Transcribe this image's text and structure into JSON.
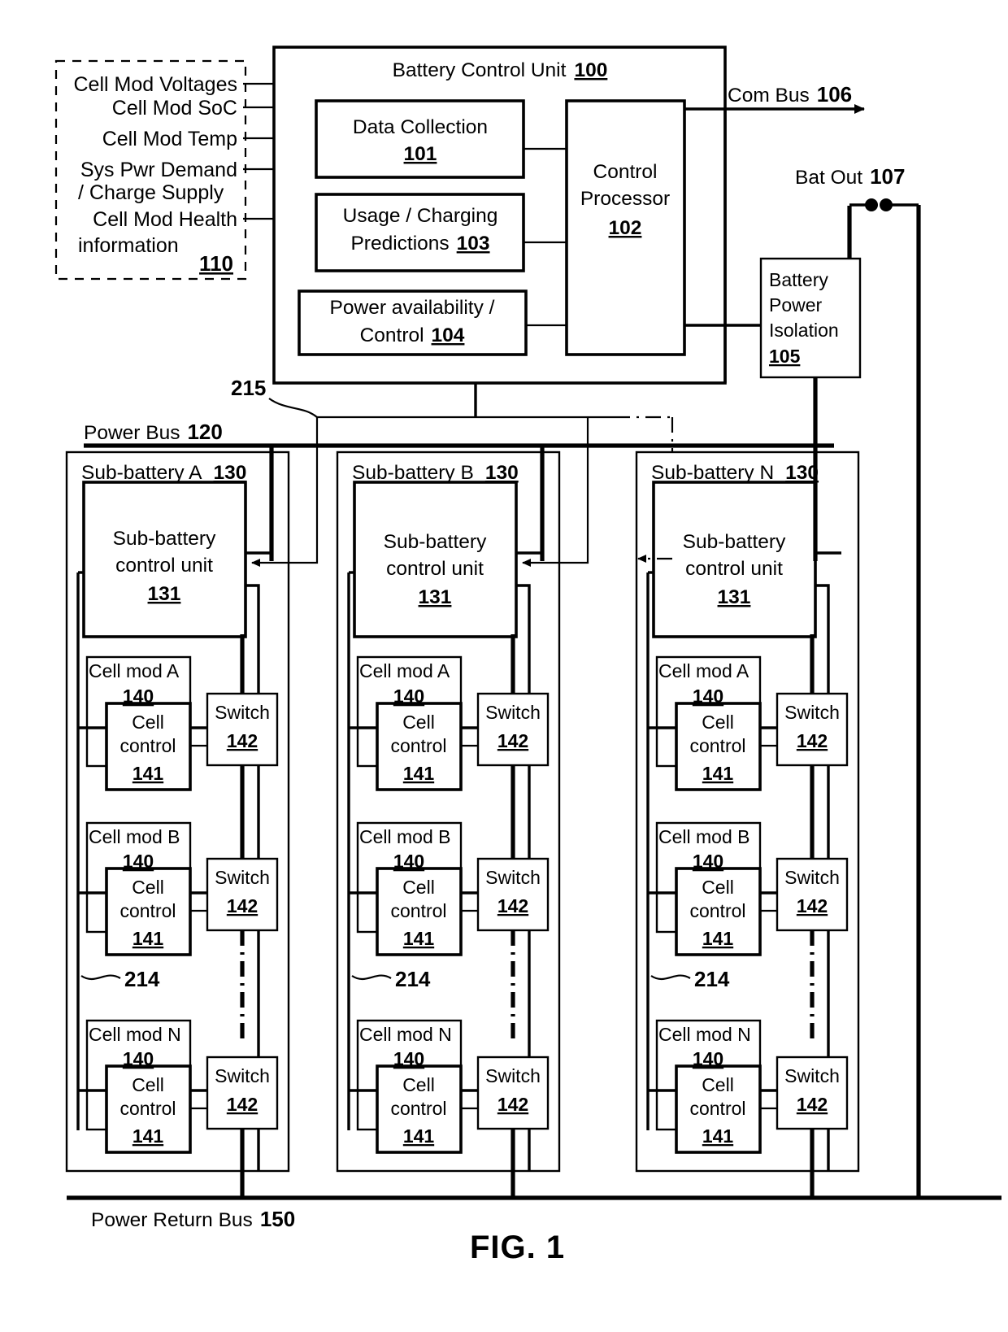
{
  "figure": {
    "label": "FIG. 1"
  },
  "inputs": {
    "ref": "110",
    "items": [
      "Cell Mod Voltages",
      "Cell Mod SoC",
      "Cell Mod Temp",
      "Sys Pwr Demand",
      "/ Charge Supply",
      "Cell Mod Health",
      "information"
    ]
  },
  "bcu": {
    "title": "Battery Control Unit",
    "ref": "100",
    "blocks": {
      "data_collection": {
        "line1": "Data Collection",
        "ref": "101"
      },
      "predictions": {
        "line1": "Usage / Charging",
        "line2": "Predictions",
        "ref": "103"
      },
      "power_avail": {
        "line1": "Power availability /",
        "line2": "Control",
        "ref": "104"
      },
      "control_processor": {
        "line1": "Control",
        "line2": "Processor",
        "ref": "102"
      }
    }
  },
  "com_bus": {
    "label": "Com Bus",
    "ref": "106"
  },
  "bat_out": {
    "label": "Bat Out",
    "ref": "107"
  },
  "isolation": {
    "line1": "Battery",
    "line2": "Power",
    "line3": "Isolation",
    "ref": "105"
  },
  "control_bus": {
    "ref": "215"
  },
  "power_bus": {
    "label": "Power Bus",
    "ref": "120"
  },
  "power_return_bus": {
    "label": "Power Return Bus",
    "ref": "150"
  },
  "ellipsis_ref": "214",
  "sub_batteries": [
    {
      "title": "Sub-battery A",
      "ref": "130",
      "control_unit": {
        "line1": "Sub-battery",
        "line2": "control unit",
        "ref": "131"
      },
      "cell_modules": [
        {
          "title": "Cell mod A",
          "ref": "140",
          "control": {
            "line1": "Cell",
            "line2": "control",
            "ref": "141"
          },
          "switch": {
            "label": "Switch",
            "ref": "142"
          }
        },
        {
          "title": "Cell mod B",
          "ref": "140",
          "control": {
            "line1": "Cell",
            "line2": "control",
            "ref": "141"
          },
          "switch": {
            "label": "Switch",
            "ref": "142"
          }
        },
        {
          "title": "Cell mod N",
          "ref": "140",
          "control": {
            "line1": "Cell",
            "line2": "control",
            "ref": "141"
          },
          "switch": {
            "label": "Switch",
            "ref": "142"
          }
        }
      ]
    },
    {
      "title": "Sub-battery B",
      "ref": "130",
      "control_unit": {
        "line1": "Sub-battery",
        "line2": "control unit",
        "ref": "131"
      },
      "cell_modules": [
        {
          "title": "Cell mod A",
          "ref": "140",
          "control": {
            "line1": "Cell",
            "line2": "control",
            "ref": "141"
          },
          "switch": {
            "label": "Switch",
            "ref": "142"
          }
        },
        {
          "title": "Cell mod B",
          "ref": "140",
          "control": {
            "line1": "Cell",
            "line2": "control",
            "ref": "141"
          },
          "switch": {
            "label": "Switch",
            "ref": "142"
          }
        },
        {
          "title": "Cell mod N",
          "ref": "140",
          "control": {
            "line1": "Cell",
            "line2": "control",
            "ref": "141"
          },
          "switch": {
            "label": "Switch",
            "ref": "142"
          }
        }
      ]
    },
    {
      "title": "Sub-battery N",
      "ref": "130",
      "control_unit": {
        "line1": "Sub-battery",
        "line2": "control unit",
        "ref": "131"
      },
      "cell_modules": [
        {
          "title": "Cell mod A",
          "ref": "140",
          "control": {
            "line1": "Cell",
            "line2": "control",
            "ref": "141"
          },
          "switch": {
            "label": "Switch",
            "ref": "142"
          }
        },
        {
          "title": "Cell mod B",
          "ref": "140",
          "control": {
            "line1": "Cell",
            "line2": "control",
            "ref": "141"
          },
          "switch": {
            "label": "Switch",
            "ref": "142"
          }
        },
        {
          "title": "Cell mod N",
          "ref": "140",
          "control": {
            "line1": "Cell",
            "line2": "control",
            "ref": "141"
          },
          "switch": {
            "label": "Switch",
            "ref": "142"
          }
        }
      ]
    }
  ]
}
